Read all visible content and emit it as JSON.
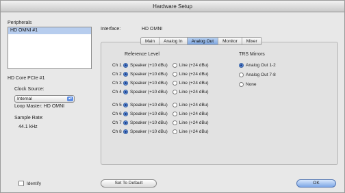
{
  "window": {
    "title": "Hardware Setup"
  },
  "peripherals": {
    "label": "Peripherals",
    "items": [
      "HD OMNI #1"
    ]
  },
  "interface": {
    "label": "Interface:",
    "value": "HD OMNI"
  },
  "device": {
    "name": "HD Core PCIe #1"
  },
  "clock": {
    "label": "Clock Source:",
    "value": "Internal",
    "loop_master": "Loop Master: HD OMNI"
  },
  "sample_rate": {
    "label": "Sample Rate:",
    "value": "44.1 kHz"
  },
  "tabs": [
    "Main",
    "Analog In",
    "Analog Out",
    "Monitor",
    "Mixer"
  ],
  "active_tab": "Analog Out",
  "reference_level": {
    "heading": "Reference Level",
    "option_speaker": "Speaker (+10 dBu)",
    "option_line": "Line (+24 dBu)",
    "channels": [
      "Ch 1",
      "Ch 2",
      "Ch 3",
      "Ch 4",
      "Ch 5",
      "Ch 6",
      "Ch 7",
      "Ch 8"
    ],
    "selected": "Speaker (+10 dBu)"
  },
  "trs_mirrors": {
    "heading": "TRS Mirrors",
    "options": [
      "Analog Out 1-2",
      "Analog Out 7-8",
      "None"
    ],
    "selected": "Analog Out 1-2"
  },
  "footer": {
    "identify": "Identify",
    "set_default": "Set To Default",
    "ok": "OK"
  }
}
